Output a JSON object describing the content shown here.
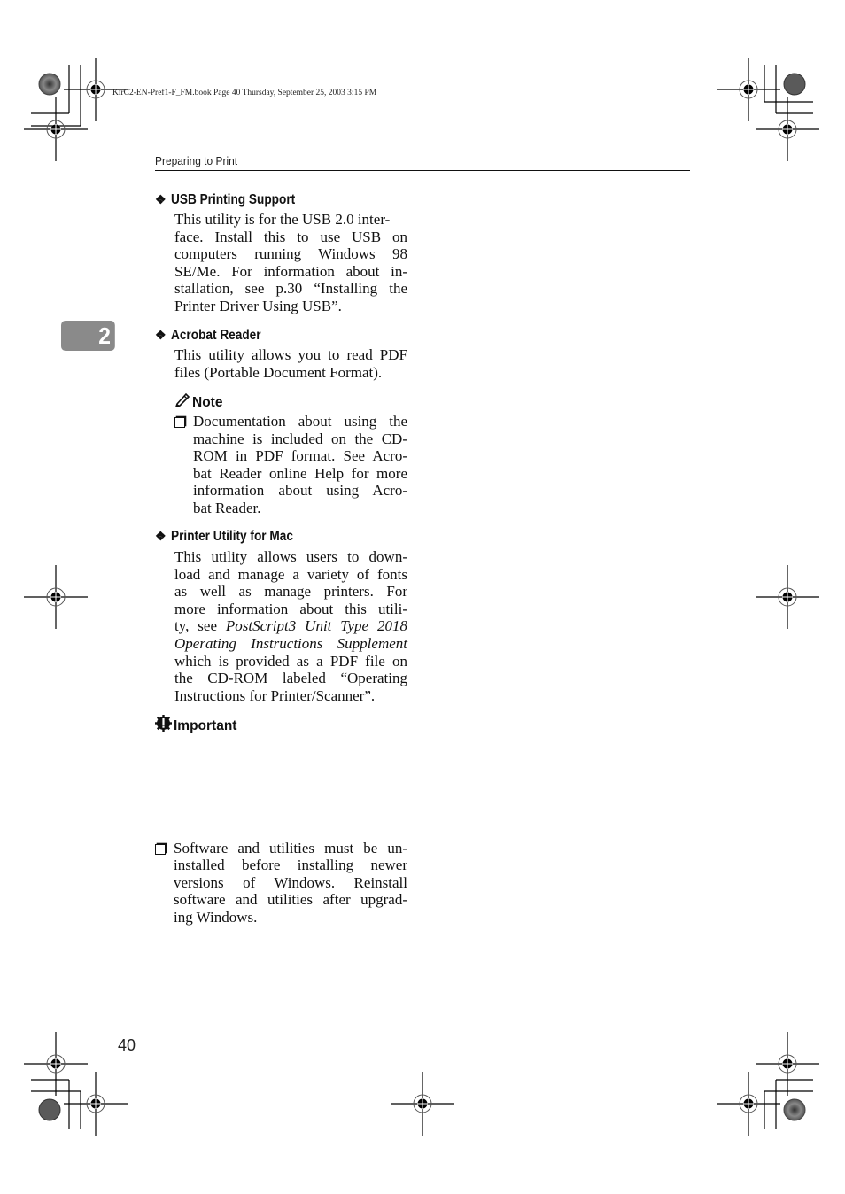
{
  "slug": "KirC2-EN-Pref1-F_FM.book  Page 40  Thursday, September 25, 2003  3:15 PM",
  "running_head": "Preparing to Print",
  "chapter_tab": "2",
  "sections": [
    {
      "title": "USB Printing Support",
      "body_lines": [
        "This utility is for the USB 2.0 inter-",
        "face. Install this to use USB on",
        "computers running Windows 98",
        "SE/Me. For information about in-",
        "stallation, see p.30 “Installing the",
        "Printer Driver Using USB”."
      ]
    },
    {
      "title": "Acrobat Reader",
      "body_lines": [
        "This utility allows you to read PDF",
        "files (Portable Document Format)."
      ],
      "note": {
        "label": "Note",
        "items": [
          {
            "lines": [
              "Documentation about using the",
              "machine is included on the CD-",
              "ROM in PDF format. See Acro-",
              "bat Reader online Help for more",
              "information about using Acro-",
              "bat Reader."
            ]
          }
        ]
      }
    },
    {
      "title": "Printer Utility for Mac",
      "body_lines": [
        "This utility allows users to down-",
        "load and manage a variety of fonts",
        "as well as manage printers. For",
        "more information about this utili-",
        "ty, see ",
        "PostScript3 Unit Type 2018",
        "Operating Instructions Supplement",
        "which is provided as a PDF file on",
        "the CD-ROM labeled “Operating",
        "Instructions for Printer/Scanner”."
      ]
    }
  ],
  "important": {
    "label": "Important",
    "items": [
      {
        "lines": [
          "Software and utilities must be un-",
          "installed before installing newer",
          "versions of Windows. Reinstall",
          "software and utilities after upgrad-",
          "ing Windows."
        ]
      }
    ]
  },
  "page_number": "40"
}
